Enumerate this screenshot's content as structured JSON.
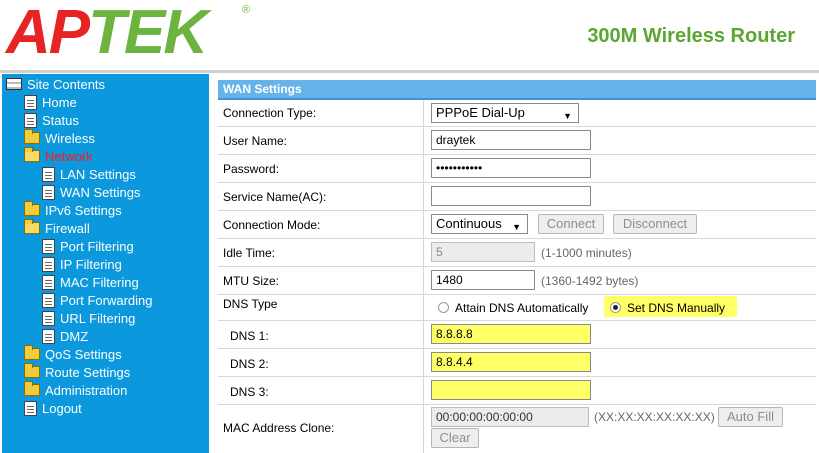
{
  "brand": {
    "logo_ap": "AP",
    "logo_tek": "TEK",
    "logo_reg": "®",
    "product": "300M Wireless Router"
  },
  "sidebar": {
    "root": "Site Contents",
    "items": [
      {
        "label": "Home",
        "icon": "doc"
      },
      {
        "label": "Status",
        "icon": "doc"
      },
      {
        "label": "Wireless",
        "icon": "folder"
      },
      {
        "label": "Network",
        "icon": "folder-open",
        "active": true
      },
      {
        "label": "LAN Settings",
        "icon": "doc"
      },
      {
        "label": "WAN Settings",
        "icon": "doc"
      },
      {
        "label": "IPv6 Settings",
        "icon": "folder"
      },
      {
        "label": "Firewall",
        "icon": "folder-open"
      },
      {
        "label": "Port Filtering",
        "icon": "doc"
      },
      {
        "label": "IP Filtering",
        "icon": "doc"
      },
      {
        "label": "MAC Filtering",
        "icon": "doc"
      },
      {
        "label": "Port Forwarding",
        "icon": "doc"
      },
      {
        "label": "URL Filtering",
        "icon": "doc"
      },
      {
        "label": "DMZ",
        "icon": "doc"
      },
      {
        "label": "QoS Settings",
        "icon": "folder"
      },
      {
        "label": "Route Settings",
        "icon": "folder"
      },
      {
        "label": "Administration",
        "icon": "folder"
      },
      {
        "label": "Logout",
        "icon": "doc"
      }
    ]
  },
  "wan": {
    "title": "WAN Settings",
    "connection_type": {
      "label": "Connection Type:",
      "value": "PPPoE Dial-Up"
    },
    "user_name": {
      "label": "User Name:",
      "value": "draytek"
    },
    "password": {
      "label": "Password:",
      "value": "•••••••••••"
    },
    "service_name": {
      "label": "Service Name(AC):",
      "value": ""
    },
    "connection_mode": {
      "label": "Connection Mode:",
      "value": "Continuous",
      "connect": "Connect",
      "disconnect": "Disconnect"
    },
    "idle_time": {
      "label": "Idle Time:",
      "value": "5",
      "hint": "(1-1000 minutes)"
    },
    "mtu": {
      "label": "MTU Size:",
      "value": "1480",
      "hint": "(1360-1492 bytes)"
    },
    "dns_type": {
      "label": "DNS Type",
      "auto": "Attain DNS Automatically",
      "manual": "Set DNS Manually",
      "selected": "manual"
    },
    "dns1": {
      "label": "DNS 1:",
      "value": "8.8.8.8"
    },
    "dns2": {
      "label": "DNS 2:",
      "value": "8.8.4.4"
    },
    "dns3": {
      "label": "DNS 3:",
      "value": ""
    },
    "mac_clone": {
      "label": "MAC Address Clone:",
      "value": "00:00:00:00:00:00",
      "hint": "(XX:XX:XX:XX:XX:XX)",
      "auto_fill": "Auto Fill",
      "clear": "Clear"
    }
  },
  "colors": {
    "sidebar": "#0b98dc",
    "header_bar": "#66b3ea",
    "highlight": "#ffff66",
    "logo_red": "#e62424",
    "logo_green": "#6cb33f"
  }
}
